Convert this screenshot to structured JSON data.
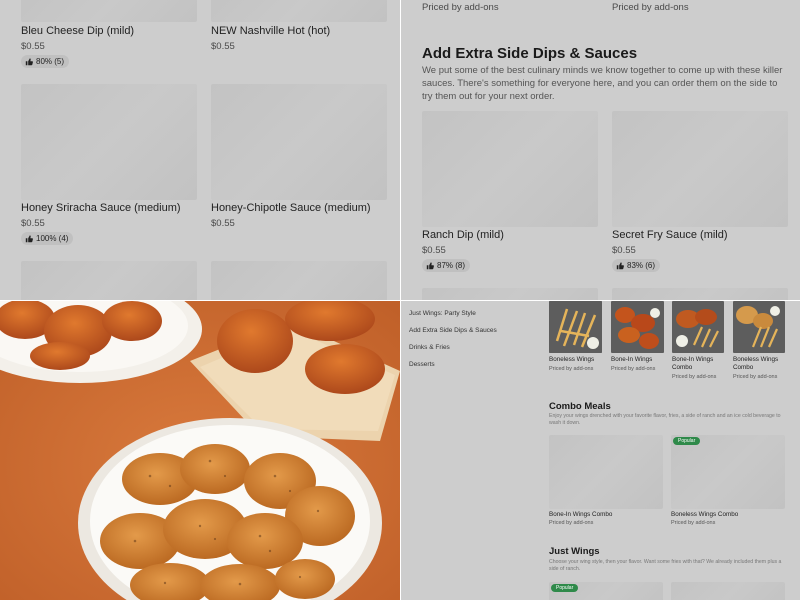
{
  "top_left": {
    "items": [
      {
        "name": "Bleu Cheese Dip (mild)",
        "price": "$0.55",
        "rating": "80% (5)"
      },
      {
        "name": "NEW Nashville Hot (hot)",
        "price": "$0.55"
      },
      {
        "name": "Honey Sriracha Sauce (medium)",
        "price": "$0.55",
        "rating": "100% (4)"
      },
      {
        "name": "Honey-Chipotle Sauce (medium)",
        "price": "$0.55"
      }
    ]
  },
  "top_right": {
    "priced_note_left": "Priced by add-ons",
    "priced_note_right": "Priced by add-ons",
    "section": {
      "title": "Add Extra Side Dips & Sauces",
      "description": "We put some of the best culinary minds we know together to come up with these killer sauces. There's something for everyone here, and you can order them on the side to try them out for your next order."
    },
    "items": [
      {
        "name": "Ranch Dip (mild)",
        "price": "$0.55",
        "rating": "87% (8)"
      },
      {
        "name": "Secret Fry Sauce (mild)",
        "price": "$0.55",
        "rating": "83% (6)"
      }
    ]
  },
  "bottom_right": {
    "nav": [
      "Just Wings: Party Style",
      "Add Extra Side Dips & Sauces",
      "Drinks & Fries",
      "Desserts"
    ],
    "row_items": [
      {
        "name": "Boneless Wings",
        "price": "Priced by add-ons"
      },
      {
        "name": "Bone-In Wings",
        "price": "Priced by add-ons"
      },
      {
        "name": "Bone-In Wings Combo",
        "price": "Priced by add-ons"
      },
      {
        "name": "Boneless Wings Combo",
        "price": "Priced by add-ons"
      }
    ],
    "combo": {
      "title": "Combo Meals",
      "description": "Enjoy your wings drenched with your favorite flavor, fries, a side of ranch and an ice cold beverage to wash it down.",
      "items": [
        {
          "name": "Bone-In Wings Combo",
          "price": "Priced by add-ons"
        },
        {
          "name": "Boneless Wings Combo",
          "price": "Priced by add-ons",
          "badge": "Popular"
        }
      ]
    },
    "just_wings": {
      "title": "Just Wings",
      "description": "Choose your wing style, then your flavor. Want some fries with that? We already included them plus a side of ranch.",
      "badge": "Popular"
    }
  },
  "colors": {
    "overlay_gray": "#cdcdcd",
    "badge_green": "#2f8a4a",
    "backdrop_orange": "#cf6c33"
  }
}
